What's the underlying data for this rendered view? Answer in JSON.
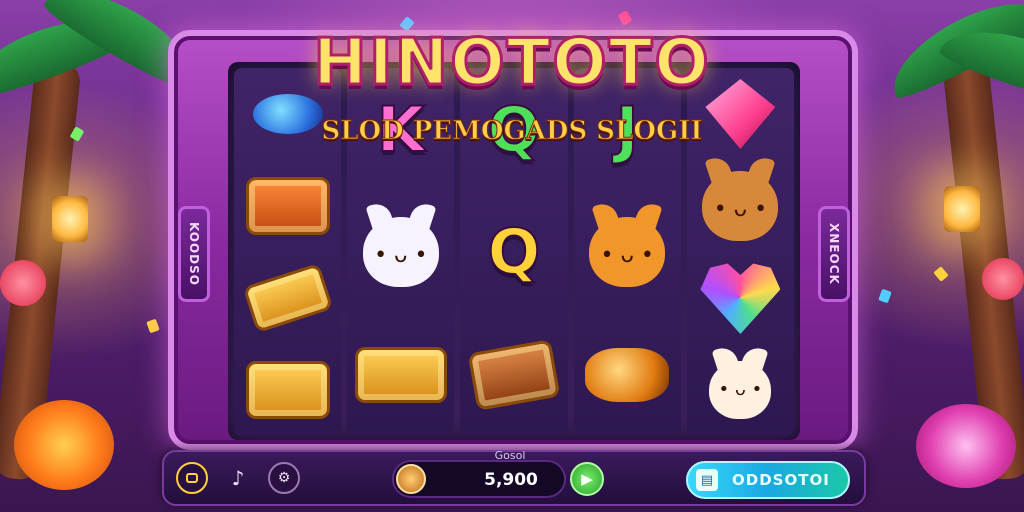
{
  "game": {
    "title": "HINOTOTO",
    "subtitle": "SLOD PEMOGADS SLOGII"
  },
  "side_panels": {
    "left_label": "KOODSO",
    "right_label": "XNEOCK"
  },
  "reels": [
    [
      {
        "icon": "swirl-orb-icon"
      },
      {
        "icon": "gold-chest-icon"
      },
      {
        "icon": "gold-key-icon"
      },
      {
        "icon": "gold-chest-icon"
      }
    ],
    [
      {
        "icon": "letter-k-icon",
        "text": "K",
        "color": "#ff6fcf"
      },
      {
        "icon": "white-cat-icon"
      },
      {
        "icon": "gold-chest-icon"
      }
    ],
    [
      {
        "icon": "letter-q-icon",
        "text": "Q",
        "color": "#4fe05a"
      },
      {
        "icon": "letter-q-gold-icon",
        "text": "Q",
        "color": "#ffd23a"
      },
      {
        "icon": "brown-chest-icon"
      }
    ],
    [
      {
        "icon": "letter-j-icon",
        "text": "J",
        "color": "#4fe05a"
      },
      {
        "icon": "fox-icon"
      },
      {
        "icon": "gold-bread-icon"
      }
    ],
    [
      {
        "icon": "pink-gem-icon"
      },
      {
        "icon": "bear-icon"
      },
      {
        "icon": "rainbow-heart-icon"
      },
      {
        "icon": "hamster-icon"
      }
    ]
  ],
  "bottom_bar": {
    "menu_icon": "menu-icon",
    "sound_icon": "music-icon",
    "settings_icon": "settings-icon",
    "balance_label": "Gosol",
    "balance_value": "5,900",
    "spin_icon": "play-icon",
    "cta_label": "ODDSOTOI"
  },
  "colors": {
    "frame": "#b64fc8",
    "title": "#ffe36a",
    "cta": "#3ad8ff",
    "spin": "#4ac83a"
  }
}
